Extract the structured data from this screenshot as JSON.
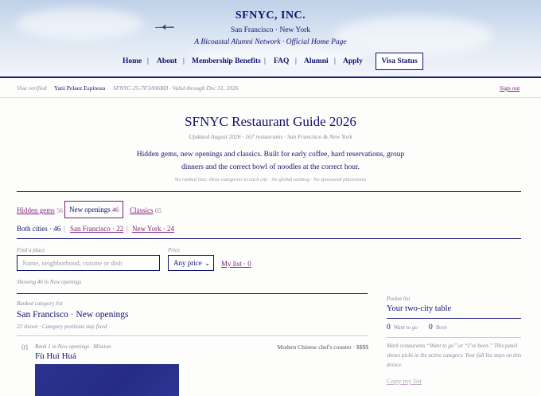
{
  "header": {
    "brand": "SFNYC, INC.",
    "cities": "San Francisco · New York",
    "tagline": "A Bicoastal Alumni Network · Official Home Page",
    "nav": [
      "Home",
      "About",
      "Membership Benefits",
      "FAQ",
      "Alumni",
      "Apply"
    ],
    "visa_button": "Visa Status"
  },
  "visa_bar": {
    "label": "Visa verified",
    "name": "Yatú Pelaez Espinosa",
    "id_text": "SFNYC-25-7F3A96BD · Valid through Dec 31, 2026",
    "sign_out": "Sign out"
  },
  "guide": {
    "title": "SFNYC Restaurant Guide 2026",
    "updated": "Updated August 2026 · 167 restaurants · San Francisco & New York",
    "intro": "Hidden gems, new openings and classics. Built for early coffee, hard reservations, group dinners and the correct bowl of noodles at the correct hour.",
    "note": "Six ranked lists: three categories in each city · No global ranking · No sponsored placements"
  },
  "tabs": [
    {
      "label": "Hidden gems",
      "count": "56"
    },
    {
      "label": "New openings",
      "count": "46"
    },
    {
      "label": "Classics",
      "count": "65"
    }
  ],
  "cities": [
    {
      "label": "Both cities · 46"
    },
    {
      "label": "San Francisco · 22"
    },
    {
      "label": "New York · 24"
    }
  ],
  "filters": {
    "find_label": "Find a place",
    "search_placeholder": "Name, neighborhood, cuisine or dish",
    "price_label": "Price",
    "price_value": "Any price",
    "my_list": "My list · 0",
    "showing": "Showing 46 in New openings"
  },
  "list": {
    "label": "Ranked category list",
    "title": "San Francisco · New openings",
    "shown": "22 shown · Category positions stay fixed",
    "entries": [
      {
        "num": "01",
        "meta": "Rank 1 in New openings · Mission",
        "cuisine": "Modern Chinese chef's counter · $$$$",
        "name": "Fù Huì Huá"
      }
    ]
  },
  "pocket": {
    "label": "Pocket list",
    "title": "Your two-city table",
    "want_count": "0",
    "want_label": "Want to go",
    "been_count": "0",
    "been_label": "Been",
    "text": "Mark restaurants “Want to go” or “I’ve been.” This panel shows picks in the active category. Your full list stays on this device.",
    "copy": "Copy my list"
  }
}
